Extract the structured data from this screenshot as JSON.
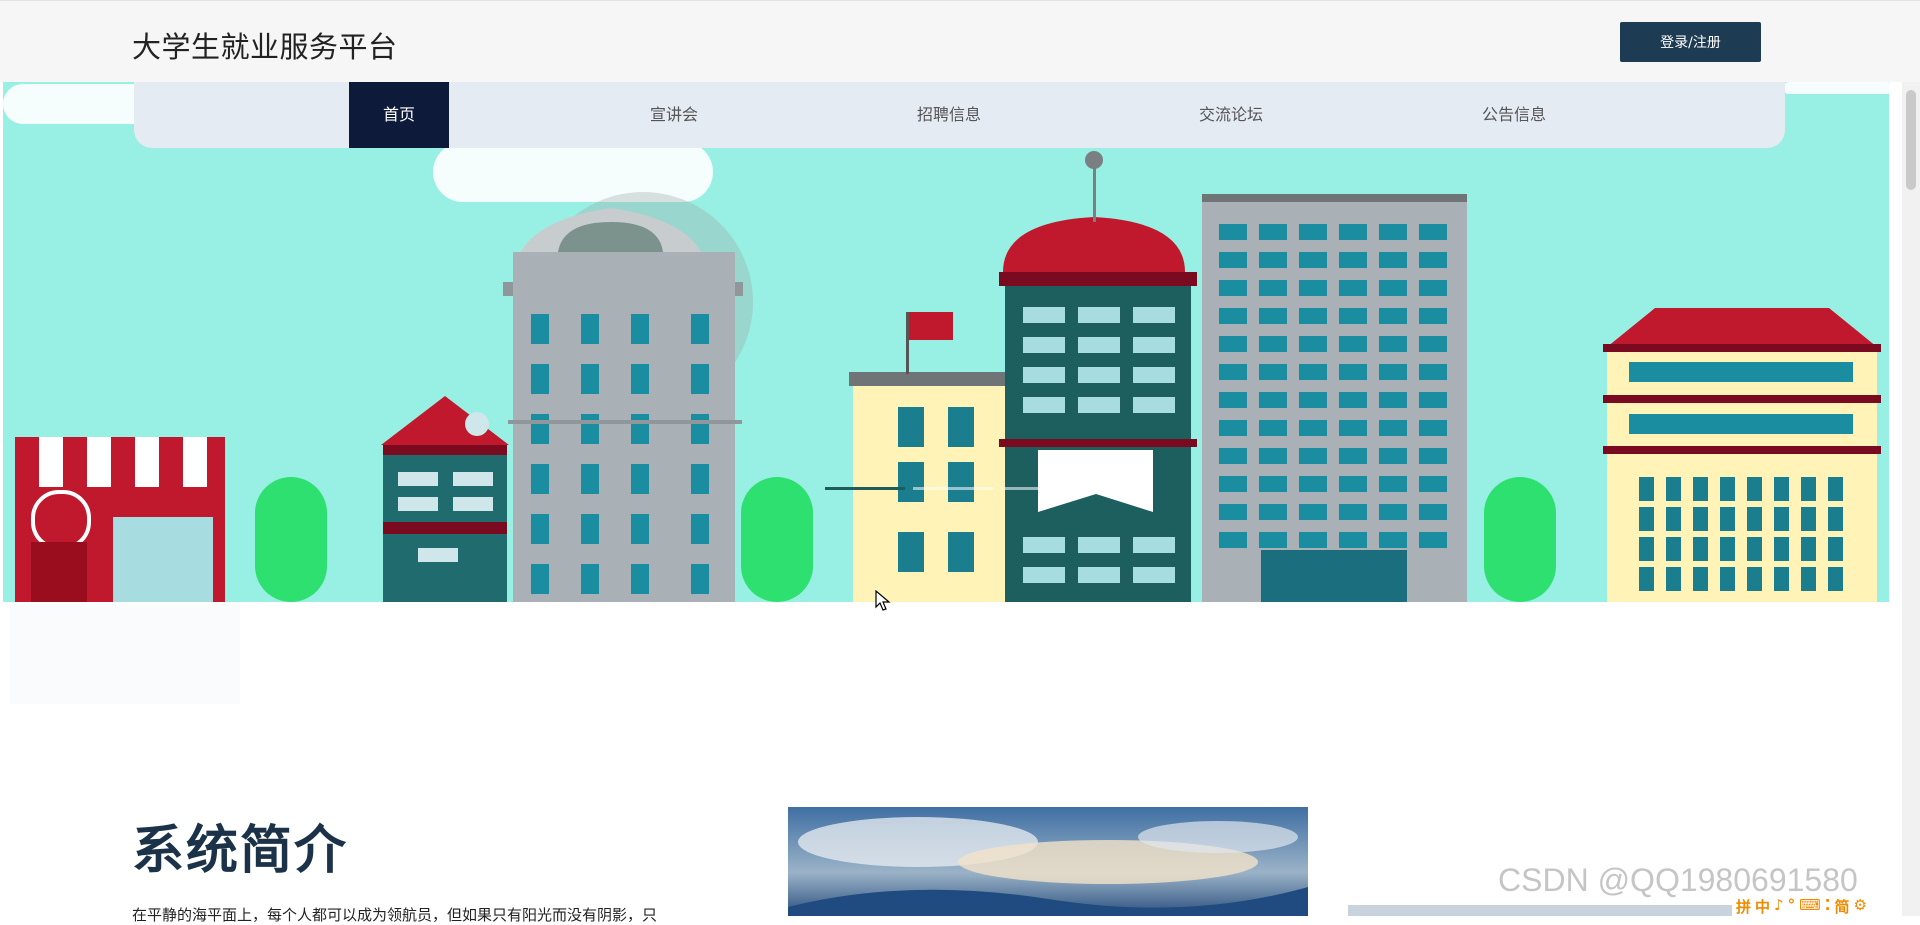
{
  "header": {
    "site_title": "大学生就业服务平台",
    "login_label": "登录/注册"
  },
  "nav": {
    "items": [
      {
        "label": "首页",
        "active": true
      },
      {
        "label": "宣讲会",
        "active": false
      },
      {
        "label": "招聘信息",
        "active": false
      },
      {
        "label": "交流论坛",
        "active": false
      },
      {
        "label": "公告信息",
        "active": false
      }
    ]
  },
  "banner": {
    "slides_total": 3,
    "active_slide": 1
  },
  "intro": {
    "title": "系统简介",
    "text": "在平静的海平面上，每个人都可以成为领航员，但如果只有阳光而没有阴影，只"
  },
  "watermark": "CSDN @QQ1980691580",
  "ime": [
    "拼",
    "中",
    "♪",
    "°",
    "⌨",
    "⁚",
    "简",
    "⚙"
  ],
  "colors": {
    "login_bg": "#1d3b52",
    "nav_active_bg": "#0d1a3a",
    "nav_bg": "#e4ebf2",
    "banner_sky": "#98efe3",
    "title_color": "#1c3248"
  }
}
